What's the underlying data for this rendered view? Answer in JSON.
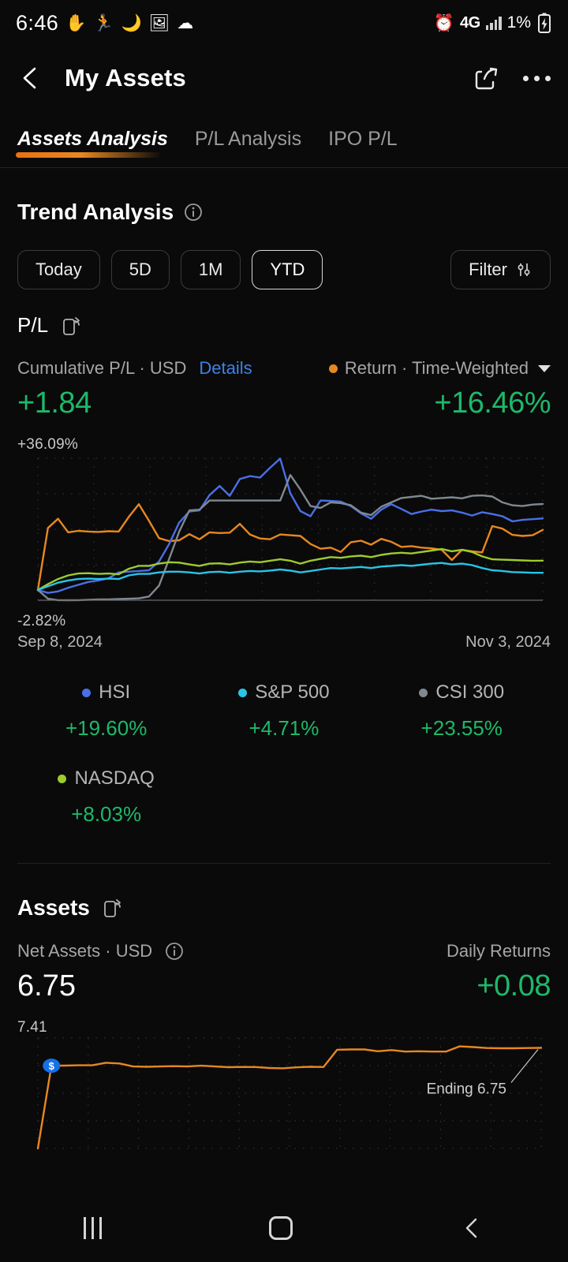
{
  "status_bar": {
    "time": "6:46",
    "left_icons": [
      "hand-icon",
      "running-icon",
      "moon-icon",
      "image-icon",
      "cloud-icon"
    ],
    "alarm_icon": "alarm-icon",
    "network": "4G",
    "battery_percent": "1%",
    "battery_charging": true
  },
  "app_bar": {
    "back_icon": "back-chevron-icon",
    "title": "My Assets",
    "share_icon": "share-icon",
    "more_icon": "more-options-icon"
  },
  "tabs": [
    {
      "label": "Assets Analysis",
      "active": true
    },
    {
      "label": "P/L Analysis",
      "active": false
    },
    {
      "label": "IPO P/L",
      "active": false
    }
  ],
  "trend_section": {
    "title": "Trend Analysis",
    "info_icon": "info-icon",
    "periods": [
      {
        "label": "Today",
        "selected": false
      },
      {
        "label": "5D",
        "selected": false
      },
      {
        "label": "1M",
        "selected": false
      },
      {
        "label": "YTD",
        "selected": true
      }
    ],
    "filter": {
      "label": "Filter",
      "icon": "sliders-icon"
    },
    "pl_label": "P/L",
    "expand_icon": "rotate-screen-icon",
    "cumulative_label": "Cumulative P/L · USD",
    "details_link": "Details",
    "return_label": "Return · Time-Weighted",
    "return_dropdown_icon": "chevron-down-icon",
    "cumulative_value": "+1.84",
    "return_value": "+16.46%"
  },
  "trend_legend": [
    {
      "name": "HSI",
      "value": "+19.60%",
      "color": "#4a6fe8"
    },
    {
      "name": "S&P 500",
      "value": "+4.71%",
      "color": "#29c5e8"
    },
    {
      "name": "CSI 300",
      "value": "+23.55%",
      "color": "#808890"
    },
    {
      "name": "NASDAQ",
      "value": "+8.03%",
      "color": "#9ecb2e"
    }
  ],
  "assets_section": {
    "title": "Assets",
    "expand_icon": "rotate-screen-icon",
    "net_assets_label": "Net Assets · USD",
    "info_icon": "info-icon",
    "net_assets_value": "6.75",
    "daily_returns_label": "Daily Returns",
    "daily_returns_value": "+0.08",
    "axis_top_label": "7.41",
    "ending_label": "Ending 6.75",
    "deposit_marker": "$"
  },
  "nav_bar": {
    "recents_icon": "recents-icon",
    "home_icon": "home-icon",
    "back_icon": "back-icon"
  },
  "colors": {
    "background": "#0a0a0a",
    "positive_green": "#1db96a",
    "accent_orange": "#e8871f",
    "link_blue": "#3d82e8",
    "muted_text": "#a6a6a6"
  },
  "chart_data": [
    {
      "type": "line",
      "title": "Cumulative P/L · Time-Weighted Return",
      "ylabel": "",
      "xlabel": "",
      "ylim": [
        -2.82,
        36.09
      ],
      "y_tick_labels": [
        "+36.09%",
        "-2.82%"
      ],
      "x_tick_labels": [
        "Sep 8, 2024",
        "Nov 3, 2024"
      ],
      "x_start": "Sep 8, 2024",
      "x_end": "Nov 3, 2024",
      "grid": "dotted",
      "legend_position": "below",
      "series": [
        {
          "name": "Return · Time-Weighted",
          "color": "#e8871f",
          "final_value": 16.46,
          "values": [
            0.0,
            17.0,
            19.5,
            15.8,
            16.2,
            16.0,
            15.9,
            16.1,
            16.0,
            20.0,
            23.5,
            19.0,
            14.2,
            13.4,
            13.6,
            15.3,
            13.9,
            15.8,
            15.6,
            15.7,
            18.1,
            15.2,
            14.1,
            13.9,
            15.2,
            15.0,
            14.8,
            12.6,
            11.3,
            11.6,
            10.4,
            13.1,
            13.5,
            12.4,
            14.0,
            13.2,
            11.8,
            12.0,
            11.6,
            11.4,
            11.0,
            8.2,
            11.0,
            10.6,
            10.3,
            17.5,
            16.8,
            15.1,
            14.8,
            15.0,
            16.46
          ]
        },
        {
          "name": "HSI",
          "color": "#4a6fe8",
          "final_value": 19.6,
          "values": [
            0.0,
            -0.8,
            -0.4,
            0.6,
            1.4,
            2.2,
            2.6,
            3.2,
            4.8,
            5.0,
            5.2,
            5.4,
            7.8,
            12.6,
            18.5,
            21.5,
            21.8,
            26.0,
            28.5,
            25.8,
            30.4,
            31.2,
            30.8,
            33.5,
            36.0,
            26.5,
            21.6,
            20.2,
            24.5,
            24.4,
            24.2,
            23.0,
            21.0,
            19.5,
            22.0,
            23.5,
            22.2,
            20.8,
            21.5,
            22.0,
            21.6,
            21.8,
            21.2,
            20.4,
            21.3,
            20.8,
            20.2,
            18.8,
            19.2,
            19.4,
            19.6
          ]
        },
        {
          "name": "CSI 300",
          "color": "#808890",
          "final_value": 23.55,
          "values": [
            0.0,
            -2.4,
            -2.8,
            -2.82,
            -2.8,
            -2.7,
            -2.6,
            -2.6,
            -2.5,
            -2.4,
            -2.3,
            -1.8,
            1.2,
            8.5,
            16.0,
            21.8,
            22.0,
            24.5,
            24.5,
            24.5,
            24.5,
            24.5,
            24.5,
            24.5,
            24.5,
            31.5,
            27.5,
            23.0,
            22.5,
            24.0,
            23.8,
            23.2,
            21.2,
            20.5,
            22.8,
            24.0,
            25.2,
            25.5,
            25.8,
            25.0,
            25.2,
            25.4,
            25.1,
            25.8,
            25.9,
            25.6,
            24.0,
            23.2,
            23.0,
            23.4,
            23.55
          ]
        },
        {
          "name": "NASDAQ",
          "color": "#9ecb2e",
          "final_value": 8.03,
          "values": [
            0.0,
            1.6,
            3.0,
            4.0,
            4.5,
            4.6,
            4.4,
            4.5,
            4.3,
            5.8,
            6.6,
            6.6,
            7.2,
            7.6,
            7.5,
            7.0,
            6.6,
            7.2,
            7.3,
            7.0,
            7.5,
            7.8,
            7.6,
            8.0,
            8.4,
            8.0,
            7.2,
            8.0,
            8.5,
            9.0,
            8.8,
            9.2,
            9.4,
            9.0,
            9.6,
            10.0,
            10.2,
            10.0,
            10.4,
            10.8,
            11.2,
            10.6,
            11.0,
            10.4,
            9.2,
            8.4,
            8.3,
            8.2,
            8.1,
            8.0,
            8.03
          ]
        },
        {
          "name": "S&P 500",
          "color": "#29c5e8",
          "final_value": 4.71,
          "values": [
            0.0,
            1.0,
            2.0,
            2.6,
            3.0,
            3.1,
            3.0,
            3.1,
            3.0,
            4.0,
            4.4,
            4.4,
            4.8,
            5.0,
            5.0,
            4.8,
            4.5,
            4.9,
            5.0,
            4.7,
            5.0,
            5.2,
            5.1,
            5.3,
            5.6,
            5.3,
            4.8,
            5.2,
            5.6,
            6.0,
            5.9,
            6.1,
            6.3,
            6.0,
            6.4,
            6.6,
            6.8,
            6.6,
            6.9,
            7.2,
            7.4,
            7.0,
            7.2,
            6.8,
            6.0,
            5.4,
            5.2,
            4.9,
            4.8,
            4.7,
            4.71
          ]
        }
      ]
    },
    {
      "type": "line",
      "title": "Net Assets · USD",
      "ylabel": "",
      "xlabel": "",
      "ylim": [
        0,
        7.41
      ],
      "y_tick_labels": [
        "7.41"
      ],
      "grid": "dotted",
      "annotation": "Ending 6.75",
      "marker_label": "$",
      "series": [
        {
          "name": "Net Assets",
          "color": "#e8871f",
          "final_value": 6.75,
          "values": [
            0.0,
            5.55,
            5.56,
            5.58,
            5.58,
            5.75,
            5.7,
            5.5,
            5.48,
            5.5,
            5.52,
            5.5,
            5.55,
            5.5,
            5.45,
            5.47,
            5.46,
            5.4,
            5.38,
            5.44,
            5.48,
            5.46,
            6.62,
            6.64,
            6.64,
            6.52,
            6.6,
            6.5,
            6.52,
            6.5,
            6.5,
            6.85,
            6.8,
            6.74,
            6.72,
            6.72,
            6.74,
            6.75
          ]
        }
      ]
    }
  ]
}
